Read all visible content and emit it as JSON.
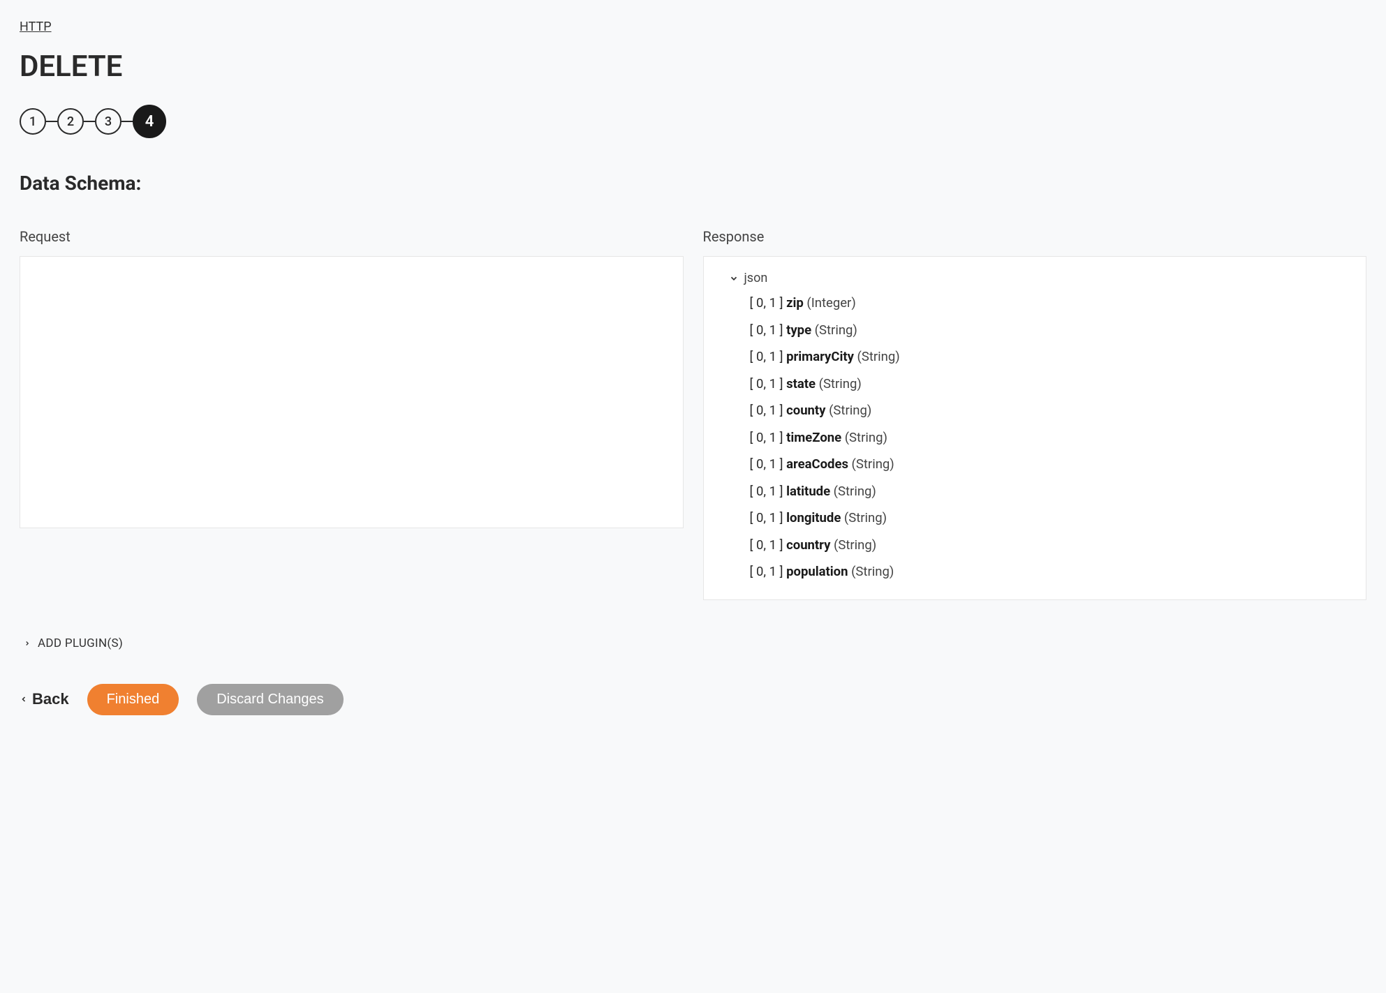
{
  "breadcrumb": "HTTP",
  "title": "DELETE",
  "stepper": {
    "steps": [
      "1",
      "2",
      "3",
      "4"
    ],
    "activeIndex": 3
  },
  "sectionTitle": "Data Schema:",
  "panels": {
    "request": {
      "label": "Request"
    },
    "response": {
      "label": "Response",
      "rootLabel": "json",
      "fields": [
        {
          "cardinality": "[ 0, 1 ]",
          "name": "zip",
          "type": "(Integer)"
        },
        {
          "cardinality": "[ 0, 1 ]",
          "name": "type",
          "type": "(String)"
        },
        {
          "cardinality": "[ 0, 1 ]",
          "name": "primaryCity",
          "type": "(String)"
        },
        {
          "cardinality": "[ 0, 1 ]",
          "name": "state",
          "type": "(String)"
        },
        {
          "cardinality": "[ 0, 1 ]",
          "name": "county",
          "type": "(String)"
        },
        {
          "cardinality": "[ 0, 1 ]",
          "name": "timeZone",
          "type": "(String)"
        },
        {
          "cardinality": "[ 0, 1 ]",
          "name": "areaCodes",
          "type": "(String)"
        },
        {
          "cardinality": "[ 0, 1 ]",
          "name": "latitude",
          "type": "(String)"
        },
        {
          "cardinality": "[ 0, 1 ]",
          "name": "longitude",
          "type": "(String)"
        },
        {
          "cardinality": "[ 0, 1 ]",
          "name": "country",
          "type": "(String)"
        },
        {
          "cardinality": "[ 0, 1 ]",
          "name": "population",
          "type": "(String)"
        }
      ]
    }
  },
  "addPlugins": "ADD PLUGIN(S)",
  "actions": {
    "back": "Back",
    "finished": "Finished",
    "discard": "Discard Changes"
  }
}
